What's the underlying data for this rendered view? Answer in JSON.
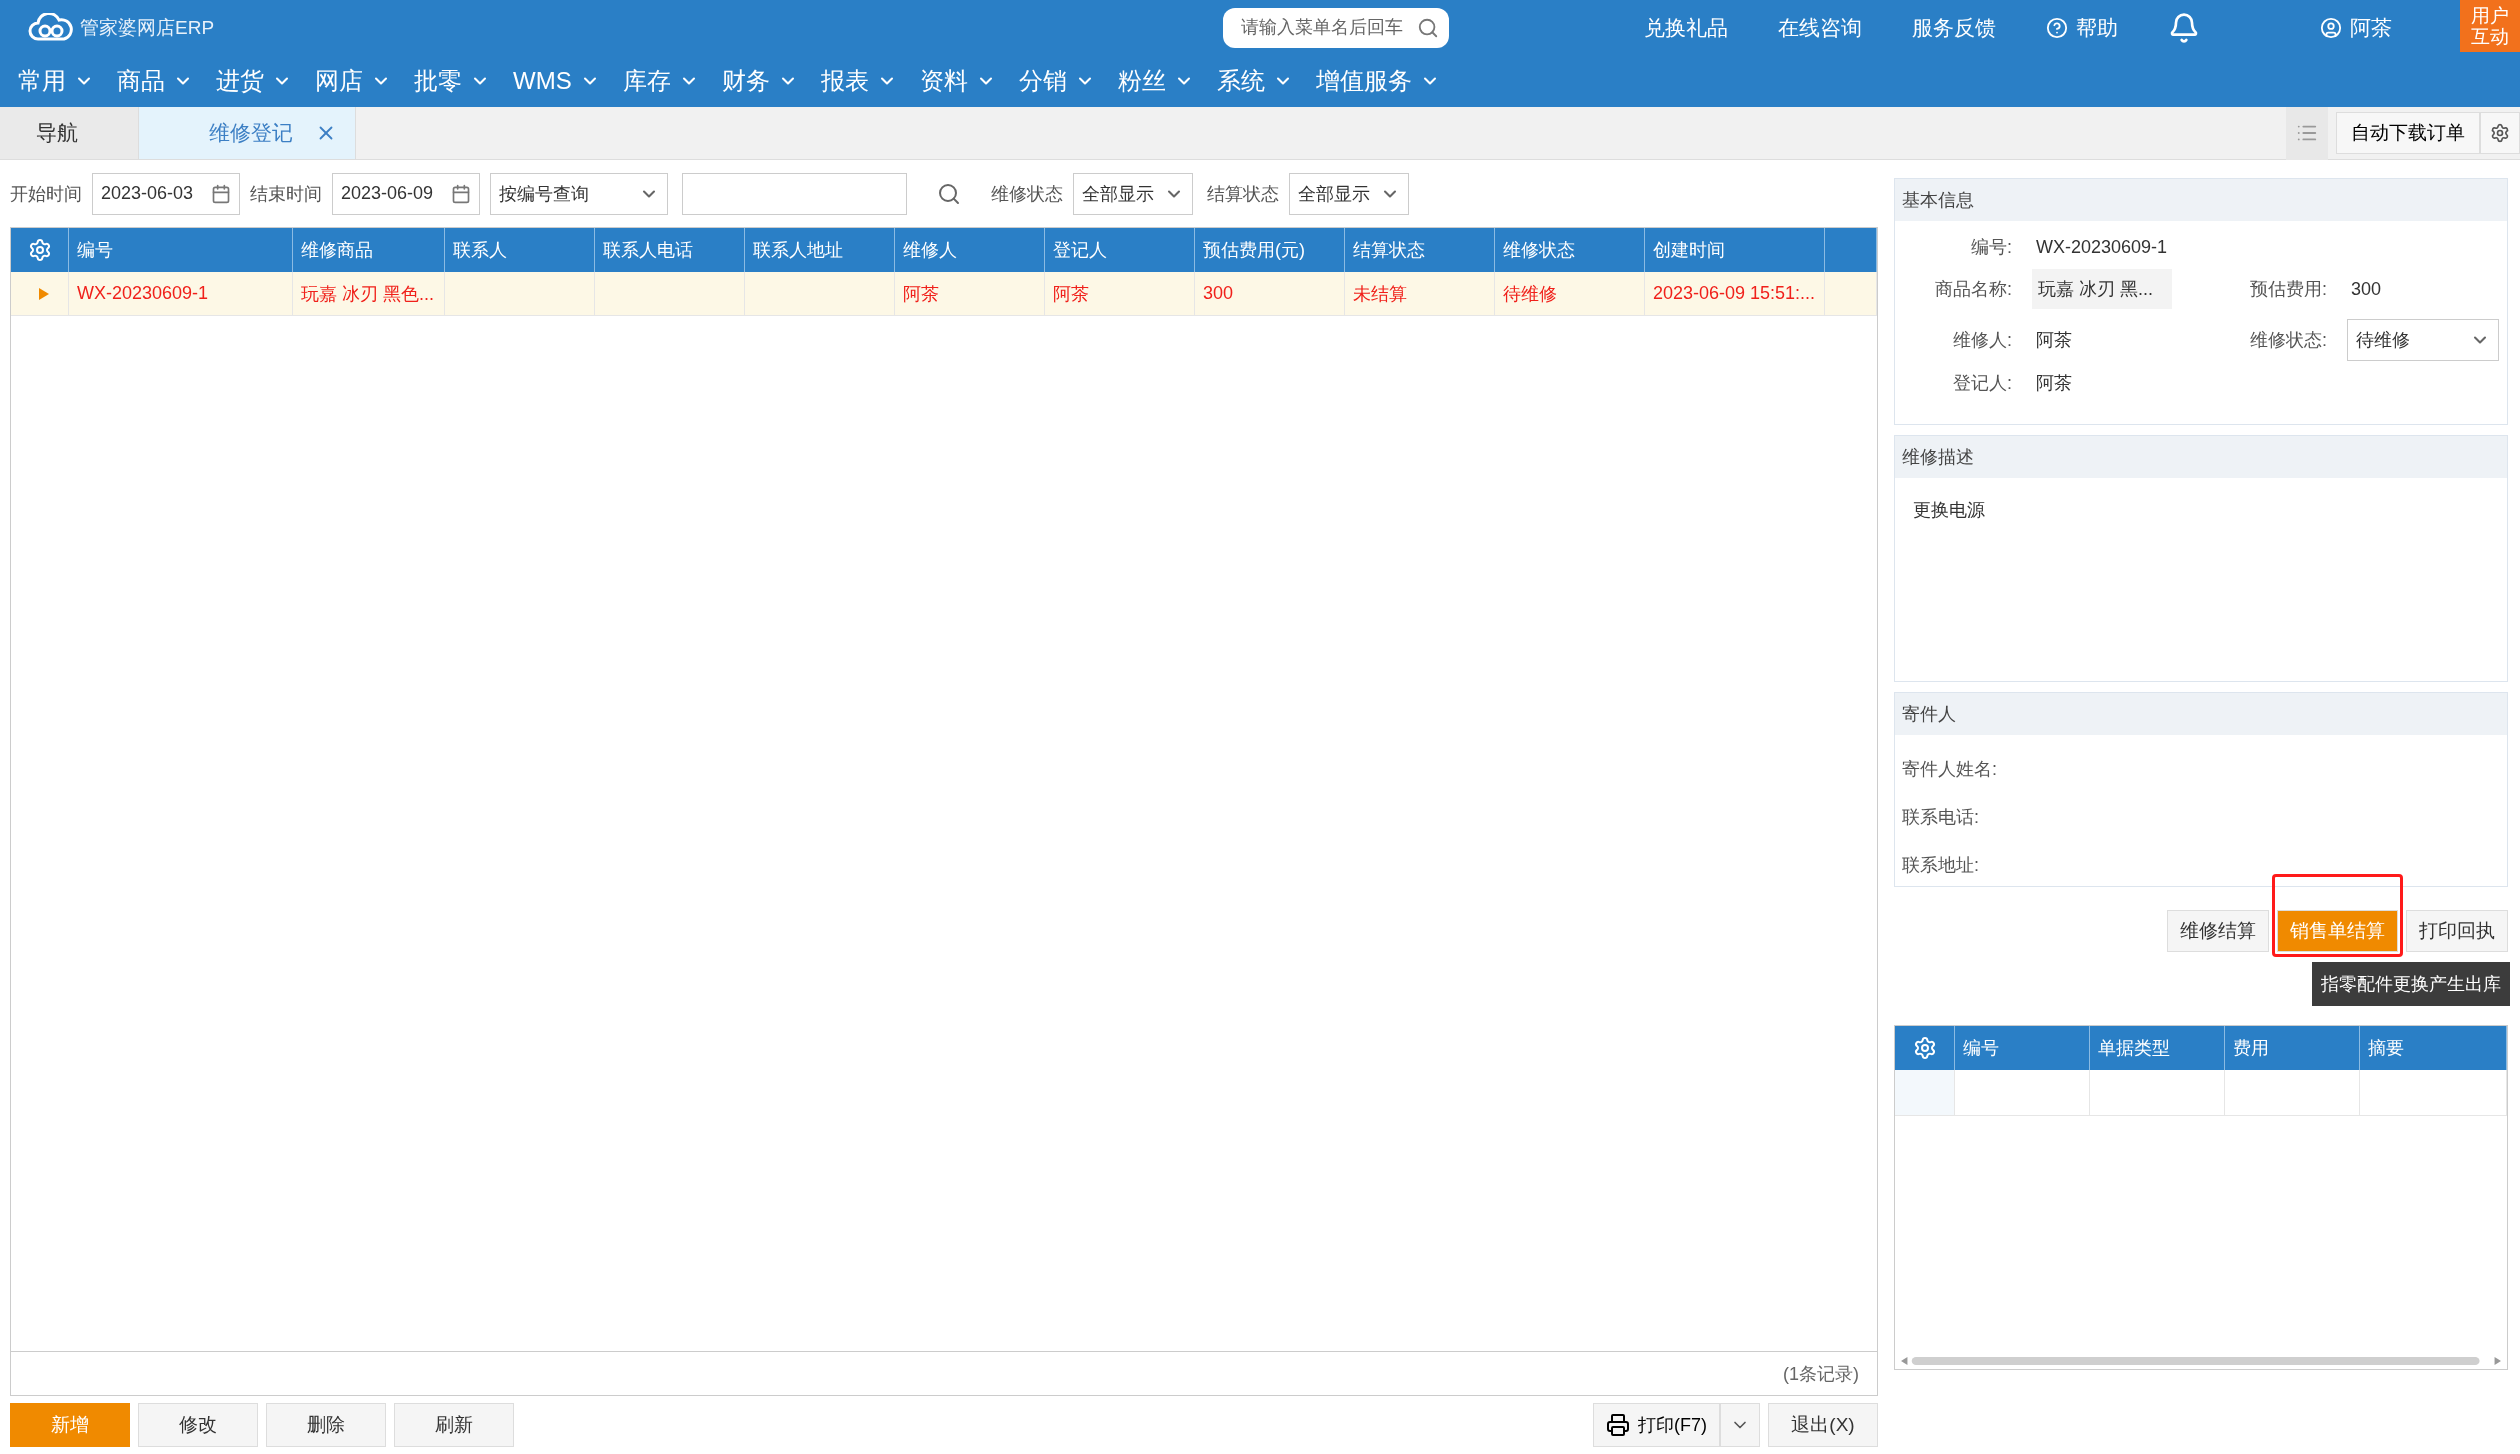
{
  "header": {
    "logo_text": "管家婆网店ERP",
    "search": {
      "placeholder": "请输入菜单名后回车"
    },
    "links": [
      "兑换礼品",
      "在线咨询",
      "服务反馈"
    ],
    "help": "帮助",
    "user": "阿茶",
    "corner_badge": [
      "用户",
      "互动"
    ]
  },
  "menu": [
    {
      "label": "常用"
    },
    {
      "label": "商品"
    },
    {
      "label": "进货"
    },
    {
      "label": "网店"
    },
    {
      "label": "批零"
    },
    {
      "label": "WMS"
    },
    {
      "label": "库存"
    },
    {
      "label": "财务"
    },
    {
      "label": "报表"
    },
    {
      "label": "资料"
    },
    {
      "label": "分销"
    },
    {
      "label": "粉丝"
    },
    {
      "label": "系统"
    },
    {
      "label": "增值服务"
    }
  ],
  "tabs": [
    {
      "label": "导航",
      "selected": false,
      "closable": false
    },
    {
      "label": "维修登记",
      "selected": true,
      "closable": true
    }
  ],
  "tab_toolbar": {
    "button": "自动下载订单"
  },
  "filters": {
    "start_label": "开始时间",
    "start_value": "2023-06-03",
    "end_label": "结束时间",
    "end_value": "2023-06-09",
    "query_mode": "按编号查询",
    "repair_status_label": "维修状态",
    "repair_status_value": "全部显示",
    "settle_status_label": "结算状态",
    "settle_status_value": "全部显示"
  },
  "table": {
    "columns": [
      "编号",
      "维修商品",
      "联系人",
      "联系人电话",
      "联系人地址",
      "维修人",
      "登记人",
      "预估费用(元)",
      "结算状态",
      "维修状态",
      "创建时间"
    ],
    "rows": [
      {
        "selected": true,
        "cells": [
          "WX-20230609-1",
          "玩嘉 冰刃 黑色...",
          "",
          "",
          "",
          "阿茶",
          "阿茶",
          "300",
          "未结算",
          "待维修",
          "2023-06-09 15:51:..."
        ]
      }
    ],
    "record_count": "(1条记录)"
  },
  "bottom_buttons": [
    {
      "label": "新增",
      "kind": "primary"
    },
    {
      "label": "修改",
      "kind": "default"
    },
    {
      "label": "删除",
      "kind": "default"
    },
    {
      "label": "刷新",
      "kind": "default"
    }
  ],
  "print_button": "打印(F7)",
  "exit_button": "退出(X)",
  "basic_info": {
    "title": "基本信息",
    "code_label": "编号:",
    "code_value": "WX-20230609-1",
    "product_label": "商品名称:",
    "product_value": "玩嘉 冰刃 黑...",
    "cost_label": "预估费用:",
    "cost_value": "300",
    "repairer_label": "维修人:",
    "repairer_value": "阿茶",
    "status_label": "维修状态:",
    "status_value": "待维修",
    "registrar_label": "登记人:",
    "registrar_value": "阿茶"
  },
  "description": {
    "title": "维修描述",
    "text": "更换电源"
  },
  "sender": {
    "title": "寄件人",
    "fields": [
      "寄件人姓名:",
      "联系电话:",
      "联系地址:"
    ]
  },
  "actions": [
    {
      "label": "维修结算",
      "highlighted": false
    },
    {
      "label": "销售单结算",
      "highlighted": true
    },
    {
      "label": "打印回执",
      "highlighted": false
    }
  ],
  "tooltip": "指零配件更换产生出库",
  "sub_table": {
    "columns": [
      "编号",
      "单据类型",
      "费用",
      "摘要"
    ]
  }
}
